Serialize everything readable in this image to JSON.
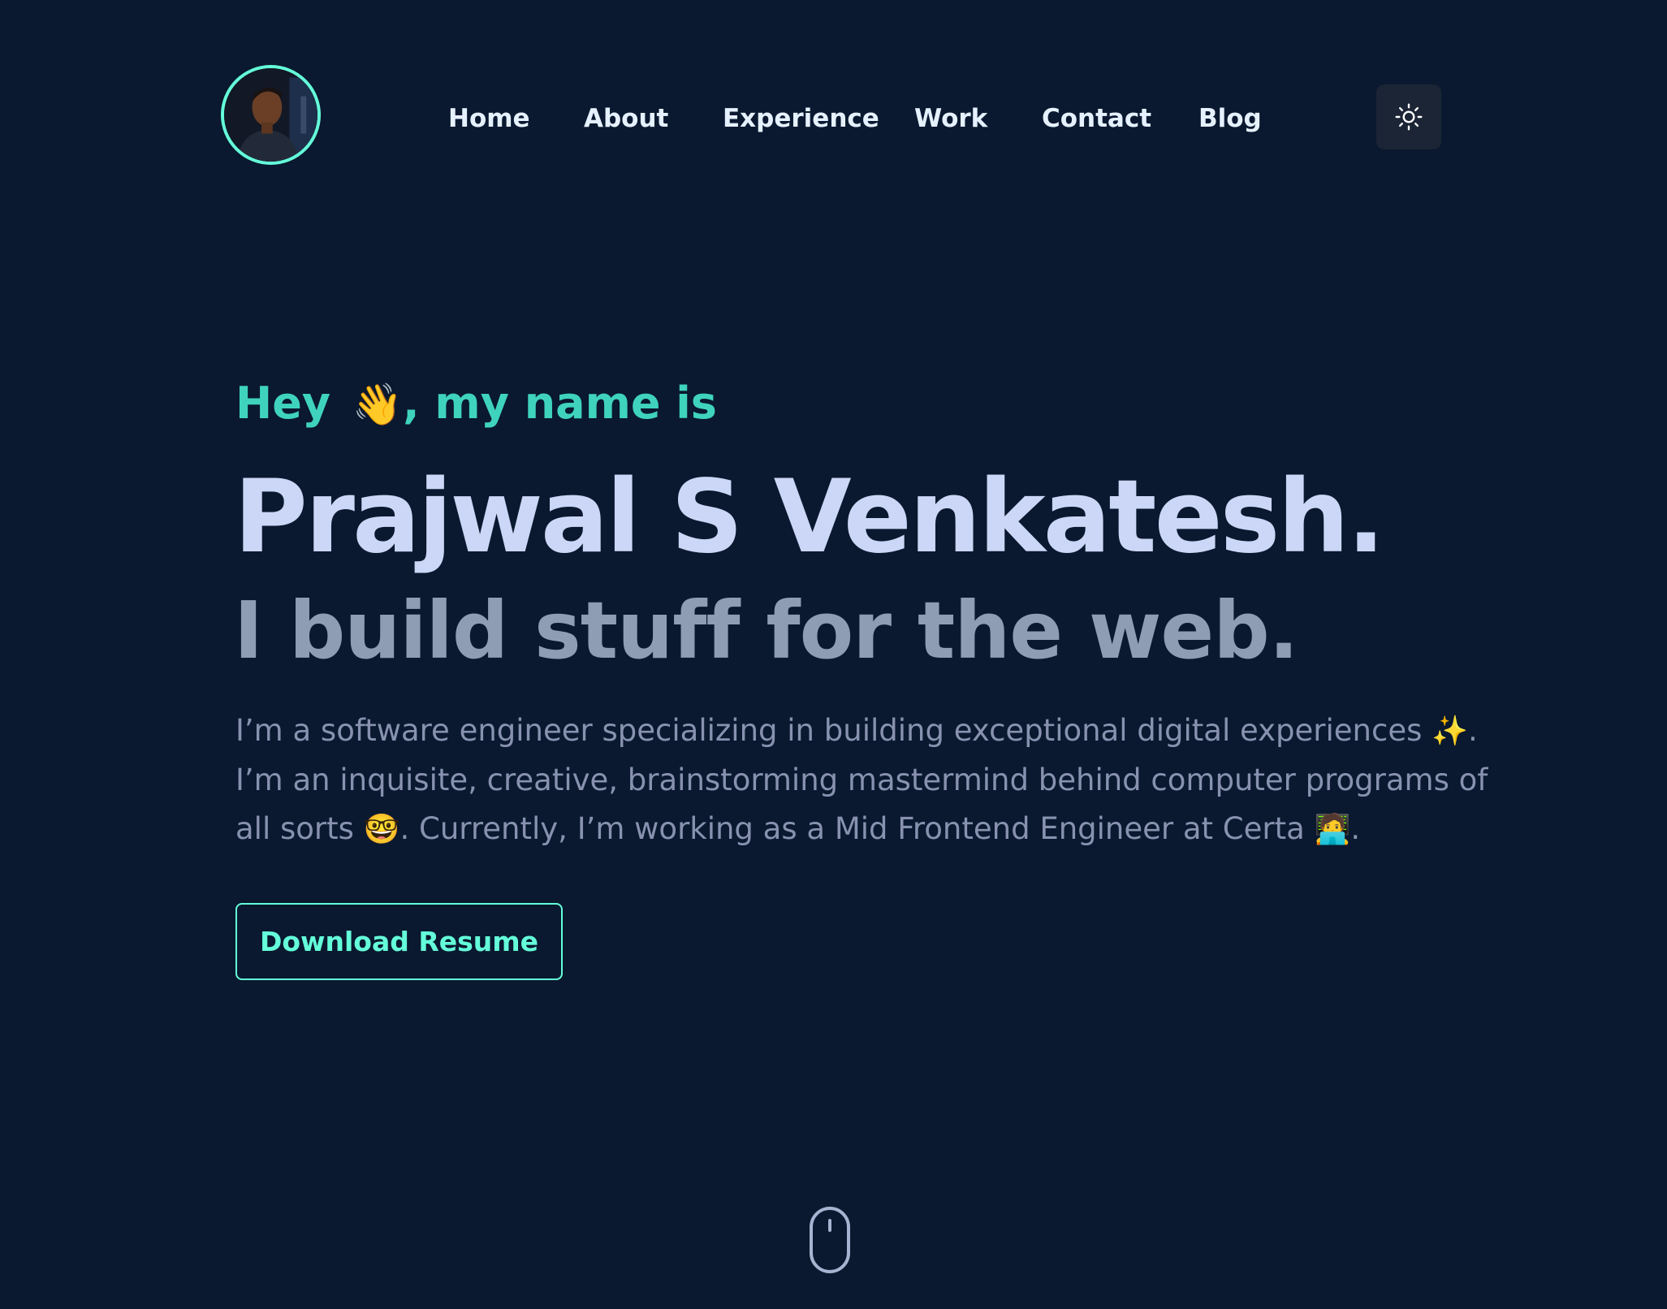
{
  "header": {
    "avatar_alt": "Profile photo",
    "nav": [
      {
        "label": "Home"
      },
      {
        "label": "About"
      },
      {
        "label": "Experience"
      },
      {
        "label": "Work"
      },
      {
        "label": "Contact"
      },
      {
        "label": "Blog"
      }
    ],
    "theme_toggle_icon": "sun-icon"
  },
  "hero": {
    "greeting_prefix": "Hey",
    "greeting_emoji": "👋",
    "greeting_suffix": ", my name is",
    "name": "Prajwal S Venkatesh.",
    "tagline": "I build stuff for the web.",
    "bio": {
      "line1_text": "I’m a software engineer specializing in building exceptional digital experiences",
      "line1_emoji": "✨",
      "line1_end": ".",
      "line2_text": "I’m an inquisite, creative, brainstorming mastermind behind computer programs of",
      "line3_start": "all sorts",
      "line3_emoji": "🤓",
      "line3_text": ". Currently, I’m working as a Mid Frontend Engineer at Certa",
      "line3_emoji2": "🧑‍💻",
      "line3_end": "."
    },
    "cta_label": "Download Resume"
  },
  "scroll_indicator_icon": "mouse-scroll-icon",
  "colors": {
    "background": "#0a192f",
    "accent": "#64ffda",
    "greeting": "#3fd3be",
    "heading": "#ccd6f6",
    "tagline": "#8f9db4",
    "body_text": "#8892b0",
    "nav_text": "#e6f1ff"
  }
}
